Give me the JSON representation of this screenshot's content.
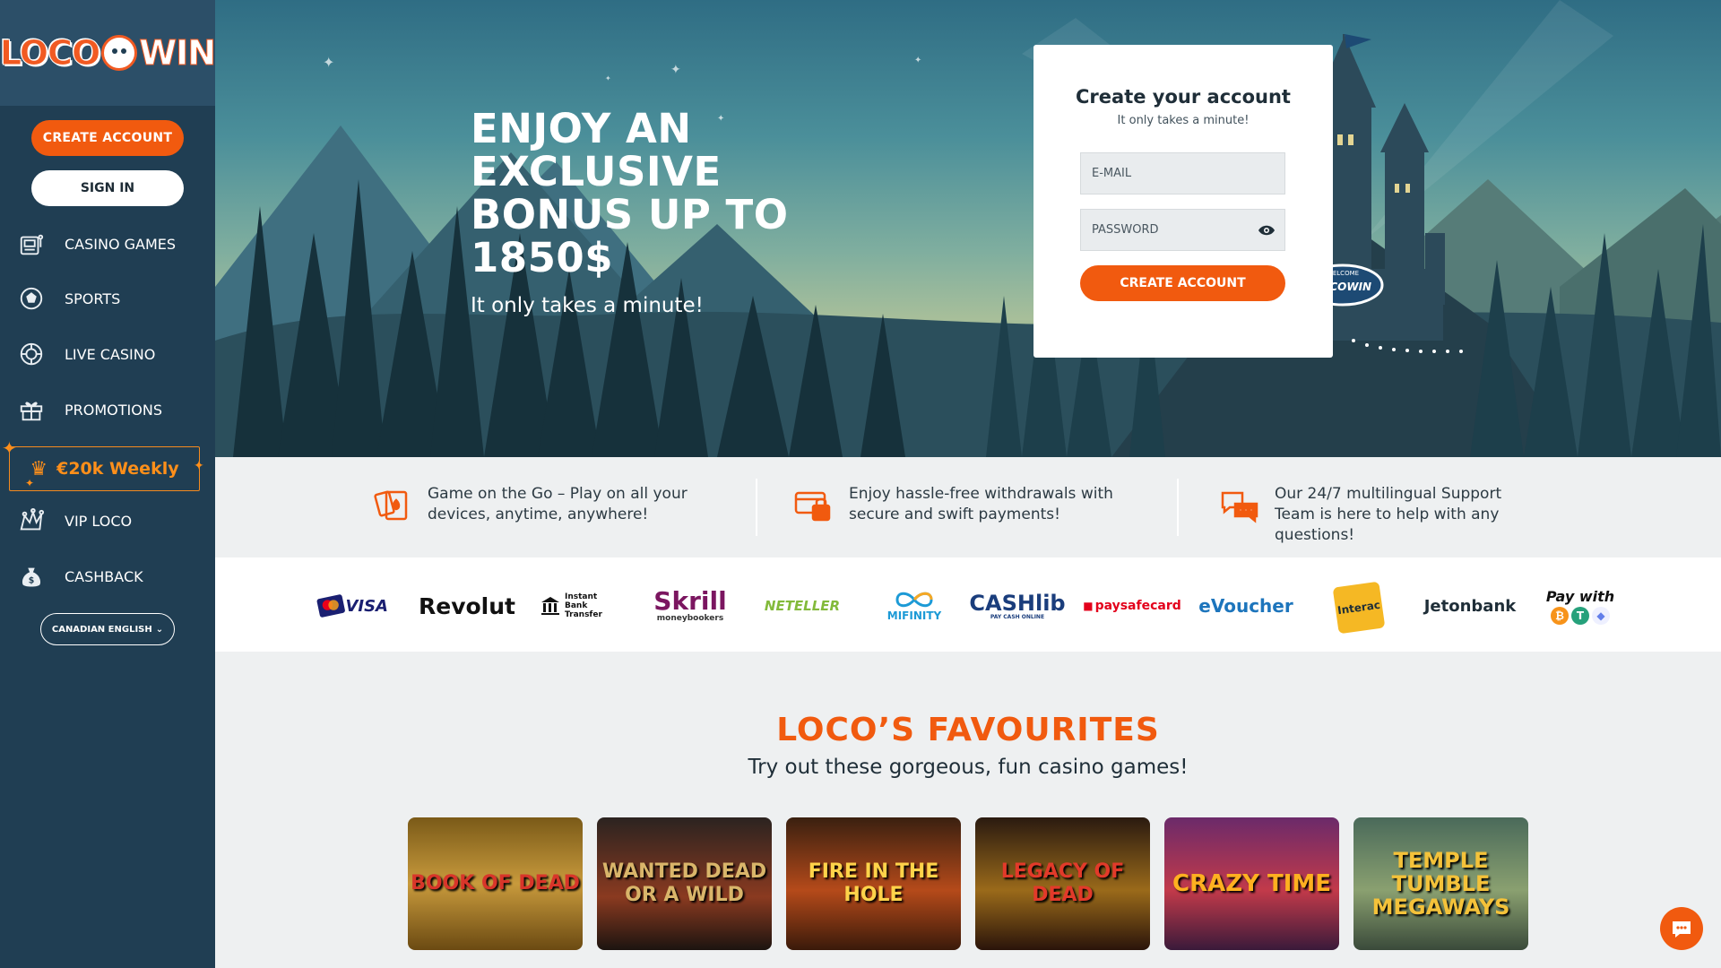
{
  "brand": {
    "logo_left": "LOCO",
    "logo_right": "WIN"
  },
  "sidebar": {
    "create_account": "CREATE ACCOUNT",
    "sign_in": "SIGN IN",
    "items": [
      {
        "label": "CASINO GAMES",
        "icon": "slot-machine-icon"
      },
      {
        "label": "SPORTS",
        "icon": "soccer-ball-icon"
      },
      {
        "label": "LIVE CASINO",
        "icon": "roulette-icon"
      },
      {
        "label": "PROMOTIONS",
        "icon": "gift-icon"
      },
      {
        "label": "VIP LOCO",
        "icon": "jester-hat-icon"
      },
      {
        "label": "CASHBACK",
        "icon": "money-bag-icon"
      }
    ],
    "weekly_promo": "€20k Weekly",
    "language": "CANADIAN ENGLISH"
  },
  "hero": {
    "title": "ENJOY AN EXCLUSIVE BONUS UP TO 1850$",
    "subtitle": "It only takes a minute!",
    "castle_sign": "LOCOWIN",
    "castle_welcome": "WELCOME"
  },
  "signup": {
    "title": "Create your account",
    "subtitle": "It only takes a minute!",
    "email_placeholder": "E-MAIL",
    "password_placeholder": "PASSWORD",
    "button": "CREATE ACCOUNT"
  },
  "features": [
    {
      "text": "Game on the Go – Play on all your devices, anytime, anywhere!",
      "icon": "cards-icon"
    },
    {
      "text": "Enjoy hassle-free withdrawals with secure and swift payments!",
      "icon": "secure-card-icon"
    },
    {
      "text": "Our 24/7 multilingual Support Team is here to help with any questions!",
      "icon": "chat-bubbles-icon"
    }
  ],
  "payments": [
    {
      "name": "VISA"
    },
    {
      "name": "Revolut"
    },
    {
      "name": "Instant Bank Transfer"
    },
    {
      "name": "Skrill",
      "sub": "moneybookers"
    },
    {
      "name": "NETELLER"
    },
    {
      "name": "MIFINITY"
    },
    {
      "name": "CASHlib",
      "sub": "PAY CASH ONLINE"
    },
    {
      "name": "paysafecard"
    },
    {
      "name": "eVoucher"
    },
    {
      "name": "Interac"
    },
    {
      "name": "Jetonbank"
    },
    {
      "name": "Pay with"
    }
  ],
  "favourites": {
    "title": "LOCO’S FAVOURITES",
    "subtitle": "Try out these gorgeous, fun casino games!",
    "games": [
      {
        "name": "BOOK OF DEAD"
      },
      {
        "name": "WANTED DEAD OR A WILD"
      },
      {
        "name": "FIRE IN THE HOLE"
      },
      {
        "name": "LEGACY OF DEAD"
      },
      {
        "name": "CRAZY TIME"
      },
      {
        "name": "TEMPLE TUMBLE MEGAWAYS"
      }
    ]
  },
  "colors": {
    "accent": "#f15a0f",
    "sidebar": "#203e53",
    "promo": "#ff8f1a"
  }
}
